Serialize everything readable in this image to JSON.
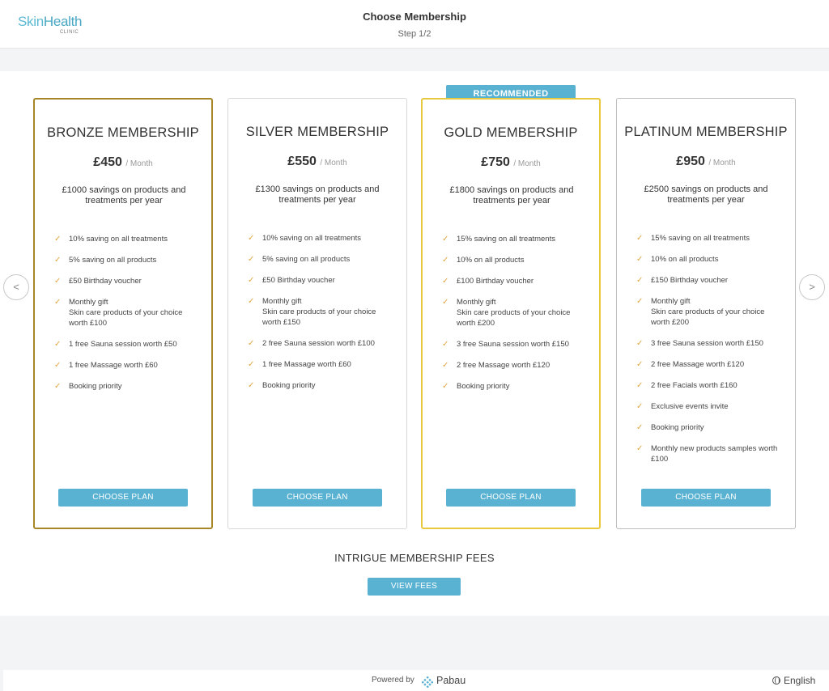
{
  "header": {
    "logo_main_a": "Skin",
    "logo_main_b": "Health",
    "logo_sub": "CLINIC",
    "title": "Choose Membership",
    "step": "Step 1/2"
  },
  "nav": {
    "prev_icon": "chevron-left-icon",
    "next_icon": "chevron-right-icon",
    "prev_glyph": "<",
    "next_glyph": ">"
  },
  "badge": "RECOMMENDED",
  "check_glyph": "✓",
  "cards": [
    {
      "title": "BRONZE MEMBERSHIP",
      "price": "£450",
      "per": "/ Month",
      "savings": "£1000 savings on products and treatments per year",
      "features": [
        "10% saving on all treatments",
        "5% saving on all products",
        "£50 Birthday voucher",
        "Monthly gift\nSkin care products of your choice worth £100",
        "1 free Sauna session worth £50",
        "1 free Massage worth £60",
        "Booking priority"
      ],
      "button": "CHOOSE PLAN"
    },
    {
      "title": "SILVER MEMBERSHIP",
      "price": "£550",
      "per": "/ Month",
      "savings": "£1300 savings on products and treatments per year",
      "features": [
        "10% saving on all treatments",
        "5% saving on all products",
        "£50 Birthday voucher",
        "Monthly gift\nSkin care products of your choice worth £150",
        "2 free Sauna session worth £100",
        "1 free Massage worth £60",
        "Booking priority"
      ],
      "button": "CHOOSE PLAN"
    },
    {
      "title": "GOLD MEMBERSHIP",
      "price": "£750",
      "per": "/ Month",
      "savings": "£1800 savings on products and treatments per year",
      "features": [
        "15% saving on all treatments",
        "10% on all products",
        "£100 Birthday voucher",
        "Monthly gift\nSkin care products of your choice worth £200",
        "3 free Sauna session worth £150",
        "2 free Massage worth £120",
        "Booking priority"
      ],
      "button": "CHOOSE PLAN"
    },
    {
      "title": "PLATINUM MEMBERSHIP",
      "price": "£950",
      "per": "/ Month",
      "savings": "£2500 savings on products and treatments per year",
      "features": [
        "15% saving on all treatments",
        "10% on all products",
        "£150 Birthday voucher",
        "Monthly gift\nSkin care products of your choice worth £200",
        "3 free Sauna session worth £150",
        "2 free Massage worth £120",
        "2 free Facials worth £160",
        "Exclusive events invite",
        "Booking priority",
        "Monthly new products samples worth £100"
      ],
      "button": "CHOOSE PLAN"
    }
  ],
  "fees": {
    "title": "INTRIGUE MEMBERSHIP FEES",
    "button": "VIEW FEES"
  },
  "footer": {
    "powered": "Powered by",
    "brand": "Pabau",
    "language": "English"
  },
  "colors": {
    "accent": "#5ab2d2",
    "bronze": "#a7862a",
    "gold": "#e8c83d",
    "check": "#e0a640"
  }
}
